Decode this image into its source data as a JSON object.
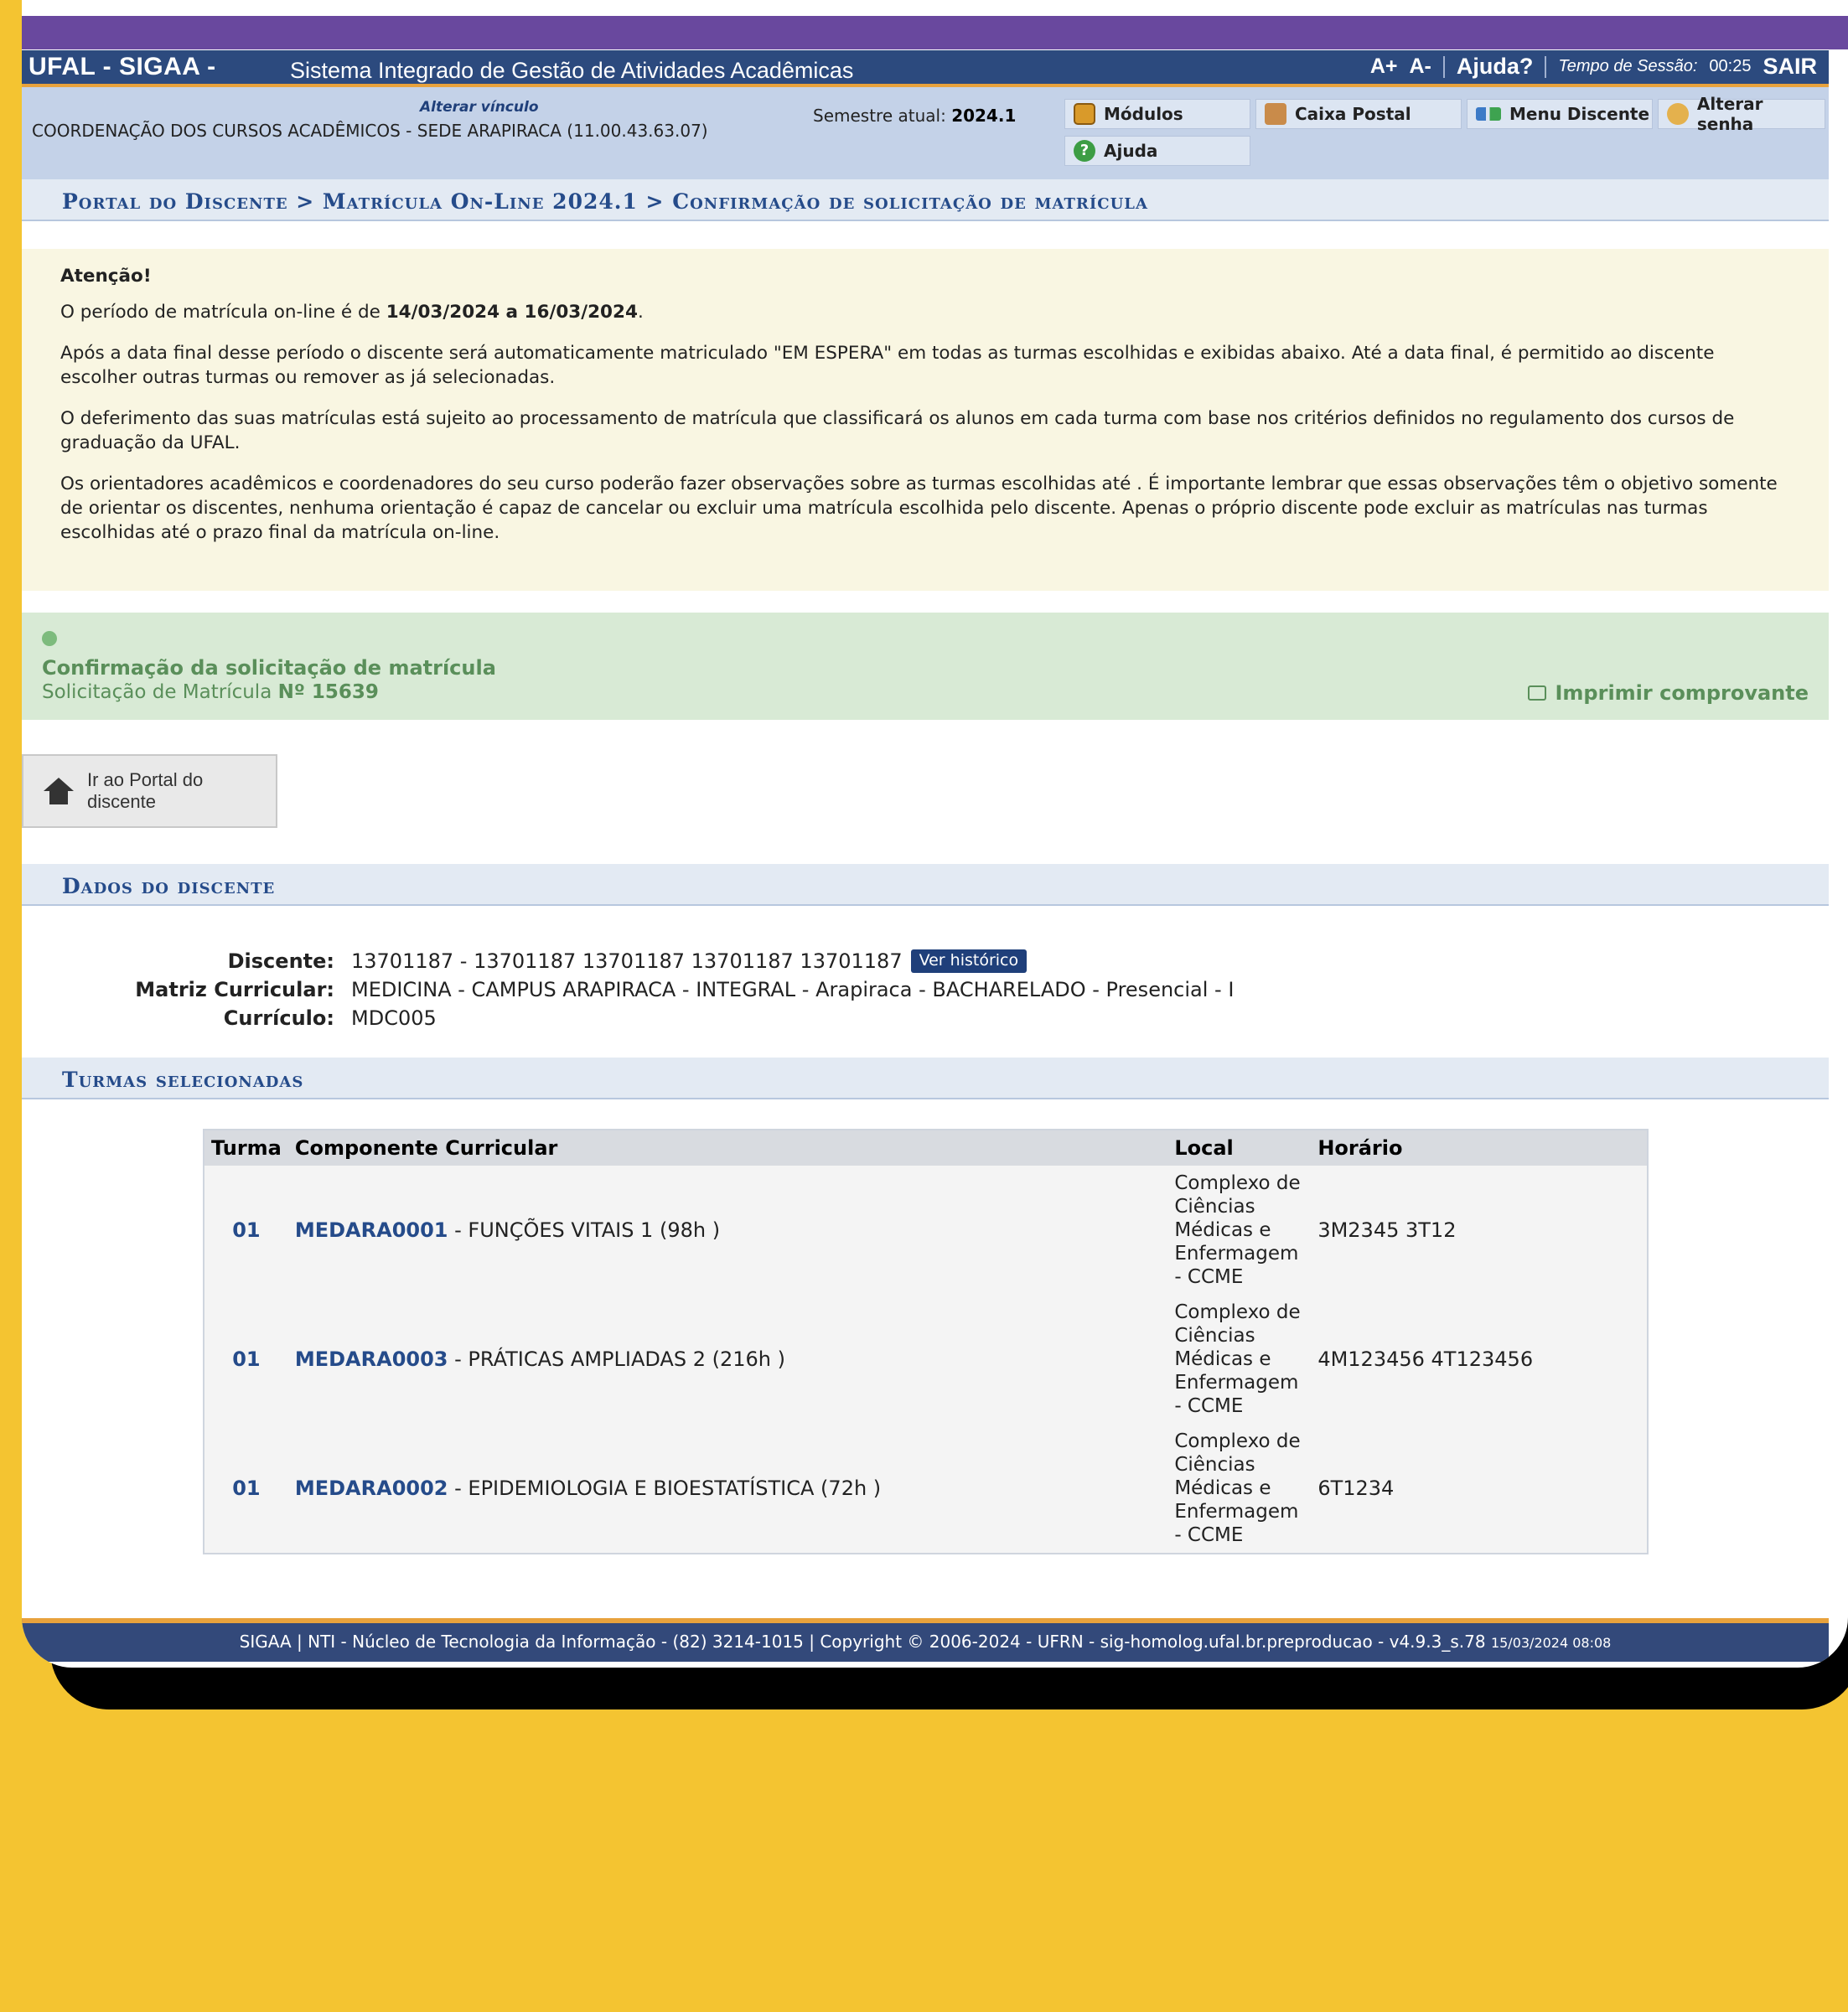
{
  "topbar": {
    "brand": "UFAL - SIGAA -",
    "system_name": "Sistema Integrado de Gestão de Atividades Acadêmicas",
    "font_increase": "A+",
    "font_decrease": "A-",
    "help": "Ajuda?",
    "session_label": "Tempo de Sessão:",
    "session_time": "00:25",
    "logout": "SAIR"
  },
  "infobar": {
    "alterar_vinculo": "Alterar vínculo",
    "unit": "COORDENAÇÃO DOS CURSOS ACADÊMICOS - SEDE ARAPIRACA (11.00.43.63.07)",
    "semester_label": "Semestre atual:",
    "semester_value": "2024.1",
    "modules": "Módulos",
    "mailbox": "Caixa Postal",
    "student_menu": "Menu Discente",
    "change_password": "Alterar senha",
    "help": "Ajuda"
  },
  "breadcrumb": "Portal do Discente > Matrícula On-Line 2024.1 > Confirmação de solicitação de matrícula",
  "notice": {
    "heading": "Atenção!",
    "period_prefix": "O período de matrícula on-line é de ",
    "period_value": "14/03/2024 a 16/03/2024",
    "period_suffix": ".",
    "p2": "Após a data final desse período o discente será automaticamente matriculado \"EM ESPERA\" em todas as turmas escolhidas e exibidas abaixo. Até a data final, é permitido ao discente escolher outras turmas ou remover as já selecionadas.",
    "p3": "O deferimento das suas matrículas está sujeito ao processamento de matrícula que classificará os alunos em cada turma com base nos critérios definidos no regulamento dos cursos de graduação da UFAL.",
    "p4": "Os orientadores acadêmicos e coordenadores do seu curso poderão fazer observações sobre as turmas escolhidas até . É importante lembrar que essas observações têm o objetivo somente de orientar os discentes, nenhuma orientação é capaz de cancelar ou excluir uma matrícula escolhida pelo discente. Apenas o próprio discente pode excluir as matrículas nas turmas escolhidas até o prazo final da matrícula on-line."
  },
  "success": {
    "title": "Confirmação da solicitação de matrícula",
    "sub_prefix": "Solicitação de Matrícula ",
    "number": "Nº 15639",
    "print": "Imprimir comprovante"
  },
  "portal_button": "Ir ao Portal do discente",
  "dados": {
    "section_title": "Dados do discente",
    "discente_label": "Discente:",
    "discente_value": "13701187 - 13701187 13701187 13701187 13701187",
    "historico": "Ver histórico",
    "matriz_label": "Matriz Curricular:",
    "matriz_value": "MEDICINA - CAMPUS ARAPIRACA - INTEGRAL - Arapiraca - BACHARELADO - Presencial - I",
    "curriculo_label": "Currículo:",
    "curriculo_value": "MDC005"
  },
  "turmas": {
    "section_title": "Turmas selecionadas",
    "headers": [
      "Turma",
      "Componente Curricular",
      "Local",
      "Horário"
    ],
    "rows": [
      {
        "turma": "01",
        "code": "MEDARA0001",
        "name": " - FUNÇÕES VITAIS 1 (98h )",
        "local": "Complexo de Ciências Médicas e Enfermagem - CCME",
        "horario": "3M2345 3T12"
      },
      {
        "turma": "01",
        "code": "MEDARA0003",
        "name": " - PRÁTICAS AMPLIADAS 2 (216h )",
        "local": "Complexo de Ciências Médicas e Enfermagem - CCME",
        "horario": "4M123456 4T123456"
      },
      {
        "turma": "01",
        "code": "MEDARA0002",
        "name": " - EPIDEMIOLOGIA E BIOESTATÍSTICA (72h )",
        "local": "Complexo de Ciências Médicas e Enfermagem - CCME",
        "horario": "6T1234"
      }
    ]
  },
  "footer": {
    "text": "SIGAA | NTI - Núcleo de Tecnologia da Informação - (82) 3214-1015 | Copyright © 2006-2024 - UFRN - sig-homolog.ufal.br.preproducao - v4.9.3_s.78",
    "timestamp": "15/03/2024 08:08"
  }
}
